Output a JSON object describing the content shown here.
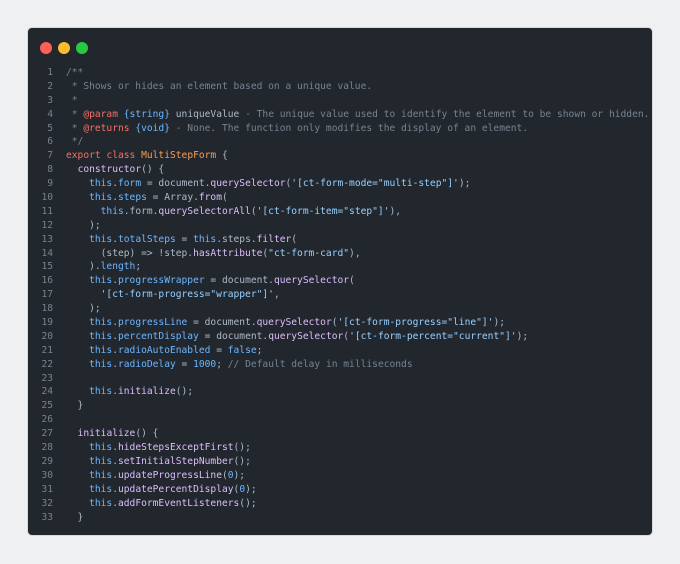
{
  "colors": {
    "background": "#22272e",
    "page": "#eef0f2",
    "window_controls": [
      "#ff5f57",
      "#febc2e",
      "#28c840"
    ],
    "tokens": {
      "cm": "#768390",
      "kw": "#f47067",
      "cls": "#f69d50",
      "fn": "#dcbdfb",
      "prop": "#6cb6ff",
      "str": "#96d0ff",
      "num": "#6cb6ff",
      "plain": "#adbac7",
      "tag": "#8ddb8c"
    }
  },
  "window_controls": {
    "close_icon": "close-dot-icon",
    "minimize_icon": "minimize-dot-icon",
    "zoom_icon": "zoom-dot-icon"
  },
  "code": {
    "lines": [
      {
        "n": "1",
        "t": [
          [
            "cm",
            "/**"
          ]
        ]
      },
      {
        "n": "2",
        "t": [
          [
            "cm",
            " * Shows or hides an element based on a unique value."
          ]
        ]
      },
      {
        "n": "3",
        "t": [
          [
            "cm",
            " *"
          ]
        ]
      },
      {
        "n": "4",
        "t": [
          [
            "cm",
            " * "
          ],
          [
            "kw",
            "@param"
          ],
          [
            "cm",
            " "
          ],
          [
            "prop",
            "{string}"
          ],
          [
            "cm",
            " "
          ],
          [
            "plain",
            "uniqueValue"
          ],
          [
            "cm",
            " - The unique value used to identify the element to be shown or hidden."
          ]
        ]
      },
      {
        "n": "5",
        "t": [
          [
            "cm",
            " * "
          ],
          [
            "kw",
            "@returns"
          ],
          [
            "cm",
            " "
          ],
          [
            "prop",
            "{void}"
          ],
          [
            "cm",
            " - None. The function only modifies the display of an element."
          ]
        ]
      },
      {
        "n": "6",
        "t": [
          [
            "cm",
            " */"
          ]
        ]
      },
      {
        "n": "7",
        "t": [
          [
            "kw",
            "export"
          ],
          [
            "plain",
            " "
          ],
          [
            "kw",
            "class"
          ],
          [
            "plain",
            " "
          ],
          [
            "cls",
            "MultiStepForm"
          ],
          [
            "plain",
            " {"
          ]
        ]
      },
      {
        "n": "8",
        "t": [
          [
            "plain",
            "  "
          ],
          [
            "fn",
            "constructor"
          ],
          [
            "plain",
            "() {"
          ]
        ]
      },
      {
        "n": "9",
        "t": [
          [
            "plain",
            "    "
          ],
          [
            "prop",
            "this"
          ],
          [
            "plain",
            "."
          ],
          [
            "prop",
            "form"
          ],
          [
            "plain",
            " = document."
          ],
          [
            "fn",
            "querySelector"
          ],
          [
            "plain",
            "("
          ],
          [
            "str",
            "'[ct-form-mode=\"multi-step\"]'"
          ],
          [
            "plain",
            ");"
          ]
        ]
      },
      {
        "n": "10",
        "t": [
          [
            "plain",
            "    "
          ],
          [
            "prop",
            "this"
          ],
          [
            "plain",
            "."
          ],
          [
            "prop",
            "steps"
          ],
          [
            "plain",
            " = Array."
          ],
          [
            "fn",
            "from"
          ],
          [
            "plain",
            "("
          ]
        ]
      },
      {
        "n": "11",
        "t": [
          [
            "plain",
            "      "
          ],
          [
            "prop",
            "this"
          ],
          [
            "plain",
            ".form."
          ],
          [
            "fn",
            "querySelectorAll"
          ],
          [
            "plain",
            "("
          ],
          [
            "str",
            "'[ct-form-item=\"step\"]'"
          ],
          [
            "plain",
            "),"
          ]
        ]
      },
      {
        "n": "12",
        "t": [
          [
            "plain",
            "    );"
          ]
        ]
      },
      {
        "n": "13",
        "t": [
          [
            "plain",
            "    "
          ],
          [
            "prop",
            "this"
          ],
          [
            "plain",
            "."
          ],
          [
            "prop",
            "totalSteps"
          ],
          [
            "plain",
            " = "
          ],
          [
            "prop",
            "this"
          ],
          [
            "plain",
            ".steps."
          ],
          [
            "fn",
            "filter"
          ],
          [
            "plain",
            "("
          ]
        ]
      },
      {
        "n": "14",
        "t": [
          [
            "plain",
            "      (step) => !step."
          ],
          [
            "fn",
            "hasAttribute"
          ],
          [
            "plain",
            "("
          ],
          [
            "str",
            "\"ct-form-card\""
          ],
          [
            "plain",
            "),"
          ]
        ]
      },
      {
        "n": "15",
        "t": [
          [
            "plain",
            "    )."
          ],
          [
            "prop",
            "length"
          ],
          [
            "plain",
            ";"
          ]
        ]
      },
      {
        "n": "16",
        "t": [
          [
            "plain",
            "    "
          ],
          [
            "prop",
            "this"
          ],
          [
            "plain",
            "."
          ],
          [
            "prop",
            "progressWrapper"
          ],
          [
            "plain",
            " = document."
          ],
          [
            "fn",
            "querySelector"
          ],
          [
            "plain",
            "("
          ]
        ]
      },
      {
        "n": "17",
        "t": [
          [
            "plain",
            "      "
          ],
          [
            "str",
            "'[ct-form-progress=\"wrapper\"]'"
          ],
          [
            "plain",
            ","
          ]
        ]
      },
      {
        "n": "18",
        "t": [
          [
            "plain",
            "    );"
          ]
        ]
      },
      {
        "n": "19",
        "t": [
          [
            "plain",
            "    "
          ],
          [
            "prop",
            "this"
          ],
          [
            "plain",
            "."
          ],
          [
            "prop",
            "progressLine"
          ],
          [
            "plain",
            " = document."
          ],
          [
            "fn",
            "querySelector"
          ],
          [
            "plain",
            "("
          ],
          [
            "str",
            "'[ct-form-progress=\"line\"]'"
          ],
          [
            "plain",
            ");"
          ]
        ]
      },
      {
        "n": "20",
        "t": [
          [
            "plain",
            "    "
          ],
          [
            "prop",
            "this"
          ],
          [
            "plain",
            "."
          ],
          [
            "prop",
            "percentDisplay"
          ],
          [
            "plain",
            " = document."
          ],
          [
            "fn",
            "querySelector"
          ],
          [
            "plain",
            "("
          ],
          [
            "str",
            "'[ct-form-percent=\"current\"]'"
          ],
          [
            "plain",
            ");"
          ]
        ]
      },
      {
        "n": "21",
        "t": [
          [
            "plain",
            "    "
          ],
          [
            "prop",
            "this"
          ],
          [
            "plain",
            "."
          ],
          [
            "prop",
            "radioAutoEnabled"
          ],
          [
            "plain",
            " = "
          ],
          [
            "num",
            "false"
          ],
          [
            "plain",
            ";"
          ]
        ]
      },
      {
        "n": "22",
        "t": [
          [
            "plain",
            "    "
          ],
          [
            "prop",
            "this"
          ],
          [
            "plain",
            "."
          ],
          [
            "prop",
            "radioDelay"
          ],
          [
            "plain",
            " = "
          ],
          [
            "num",
            "1000"
          ],
          [
            "plain",
            "; "
          ],
          [
            "cm",
            "// Default delay in milliseconds"
          ]
        ]
      },
      {
        "n": "23",
        "t": [
          [
            "plain",
            ""
          ]
        ]
      },
      {
        "n": "24",
        "t": [
          [
            "plain",
            "    "
          ],
          [
            "prop",
            "this"
          ],
          [
            "plain",
            "."
          ],
          [
            "fn",
            "initialize"
          ],
          [
            "plain",
            "();"
          ]
        ]
      },
      {
        "n": "25",
        "t": [
          [
            "plain",
            "  }"
          ]
        ]
      },
      {
        "n": "26",
        "t": [
          [
            "plain",
            ""
          ]
        ]
      },
      {
        "n": "27",
        "t": [
          [
            "plain",
            "  "
          ],
          [
            "fn",
            "initialize"
          ],
          [
            "plain",
            "() {"
          ]
        ]
      },
      {
        "n": "28",
        "t": [
          [
            "plain",
            "    "
          ],
          [
            "prop",
            "this"
          ],
          [
            "plain",
            "."
          ],
          [
            "fn",
            "hideStepsExceptFirst"
          ],
          [
            "plain",
            "();"
          ]
        ]
      },
      {
        "n": "29",
        "t": [
          [
            "plain",
            "    "
          ],
          [
            "prop",
            "this"
          ],
          [
            "plain",
            "."
          ],
          [
            "fn",
            "setInitialStepNumber"
          ],
          [
            "plain",
            "();"
          ]
        ]
      },
      {
        "n": "30",
        "t": [
          [
            "plain",
            "    "
          ],
          [
            "prop",
            "this"
          ],
          [
            "plain",
            "."
          ],
          [
            "fn",
            "updateProgressLine"
          ],
          [
            "plain",
            "("
          ],
          [
            "num",
            "0"
          ],
          [
            "plain",
            ");"
          ]
        ]
      },
      {
        "n": "31",
        "t": [
          [
            "plain",
            "    "
          ],
          [
            "prop",
            "this"
          ],
          [
            "plain",
            "."
          ],
          [
            "fn",
            "updatePercentDisplay"
          ],
          [
            "plain",
            "("
          ],
          [
            "num",
            "0"
          ],
          [
            "plain",
            ");"
          ]
        ]
      },
      {
        "n": "32",
        "t": [
          [
            "plain",
            "    "
          ],
          [
            "prop",
            "this"
          ],
          [
            "plain",
            "."
          ],
          [
            "fn",
            "addFormEventListeners"
          ],
          [
            "plain",
            "();"
          ]
        ]
      },
      {
        "n": "33",
        "t": [
          [
            "plain",
            "  }"
          ]
        ]
      }
    ]
  }
}
